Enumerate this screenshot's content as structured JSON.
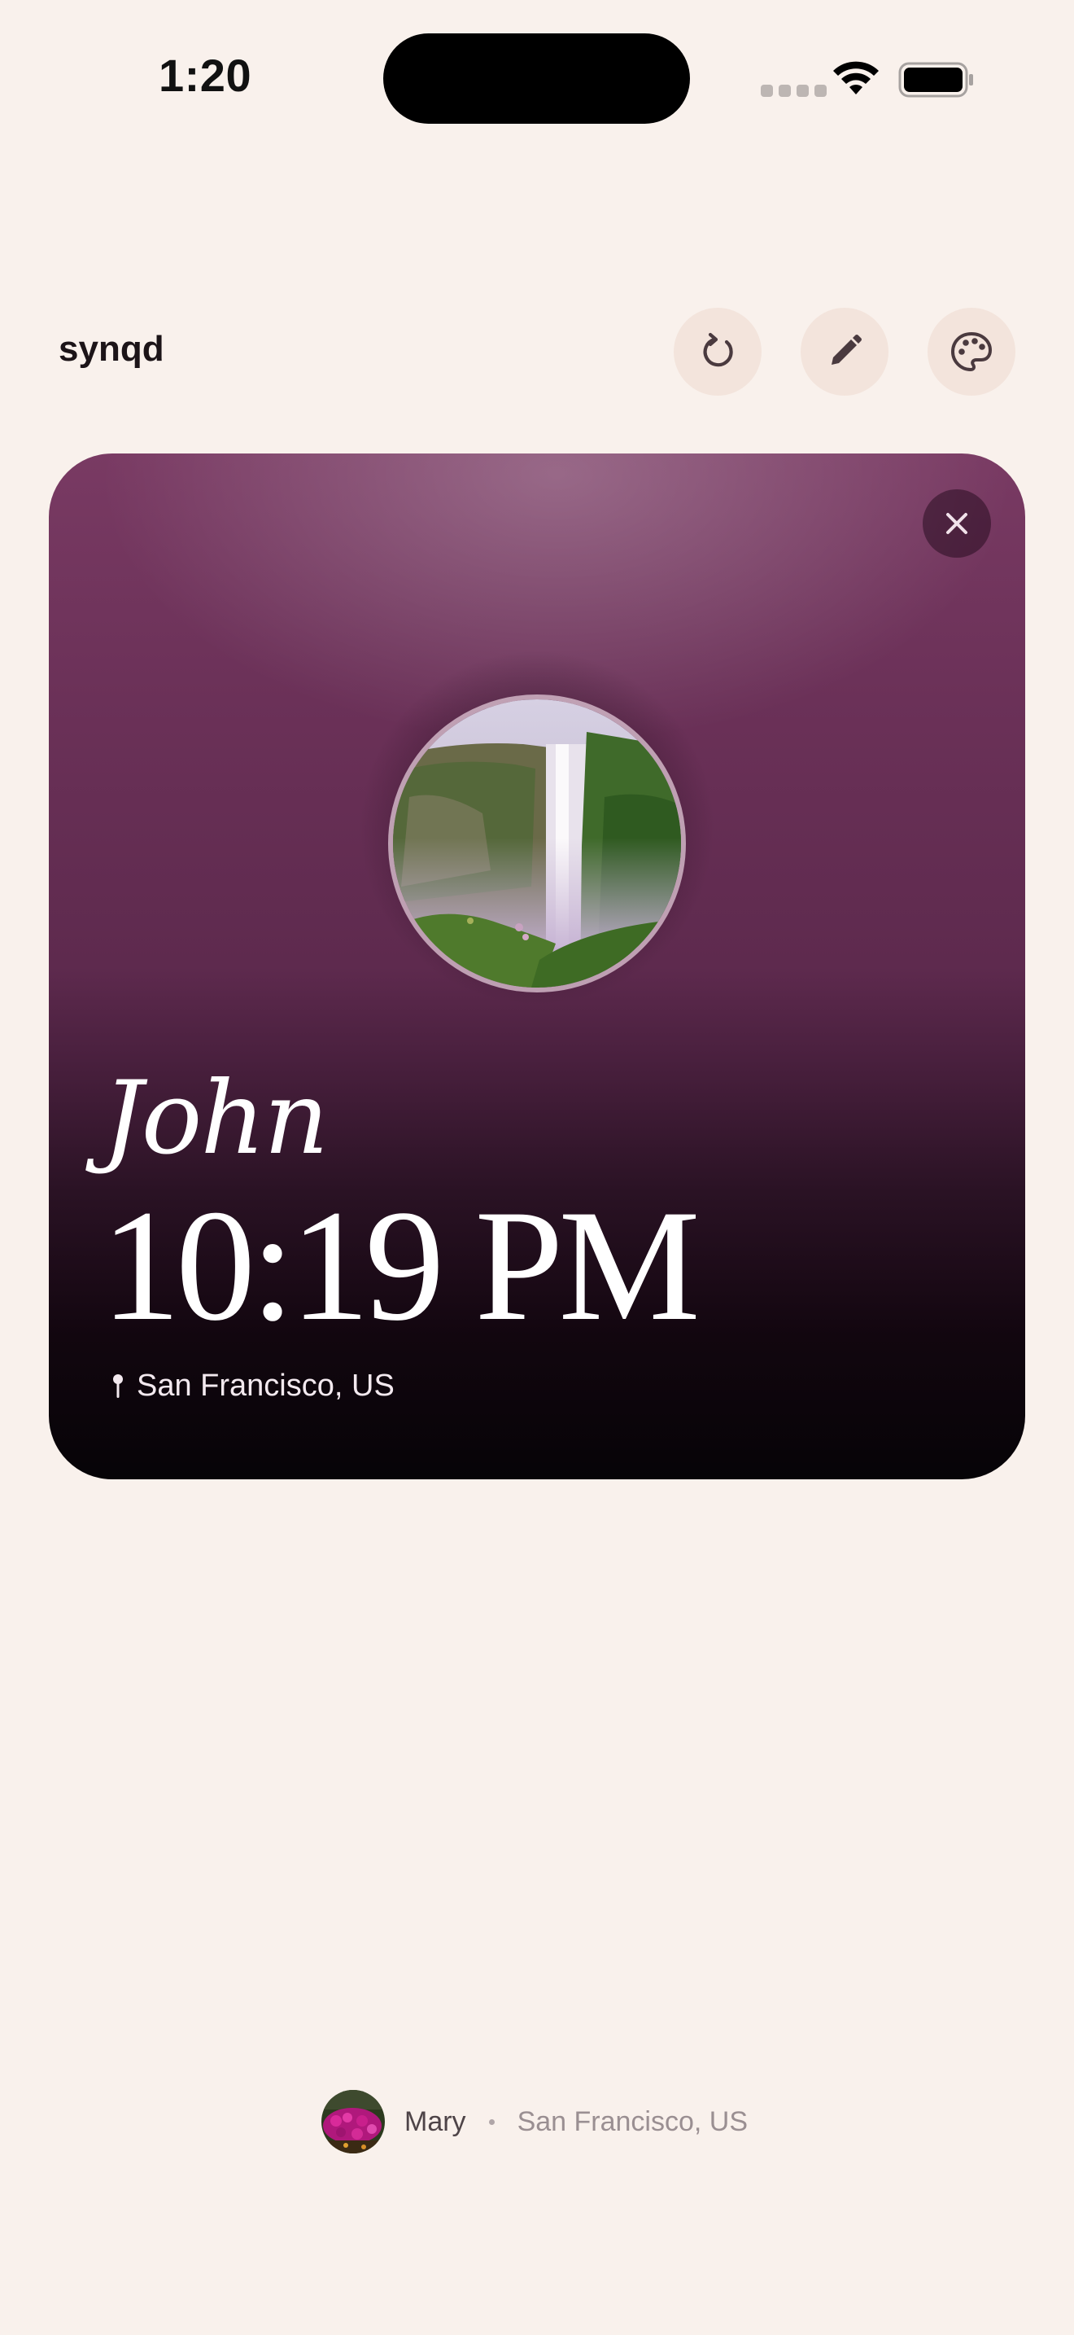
{
  "status_bar": {
    "time": "1:20",
    "icons": [
      "signal-dots-icon",
      "wifi-icon",
      "battery-icon"
    ]
  },
  "header": {
    "app_title": "synqd",
    "buttons": [
      {
        "name": "refresh",
        "icon": "refresh-icon"
      },
      {
        "name": "edit",
        "icon": "pencil-icon"
      },
      {
        "name": "theme",
        "icon": "palette-icon"
      }
    ]
  },
  "card": {
    "name": "John",
    "time": "10:19 PM",
    "location": "San Francisco, US",
    "avatar": "waterfall-photo",
    "close_icon": "close-icon",
    "location_icon": "pin-icon",
    "colors": {
      "top": "#793a63",
      "mid": "#5e2a4e",
      "bottom": "#060407"
    }
  },
  "me": {
    "name": "Mary",
    "location": "San Francisco, US",
    "avatar": "flowers-photo"
  },
  "colors": {
    "background": "#f9f1ec",
    "button_bg": "#f3e4dc"
  }
}
